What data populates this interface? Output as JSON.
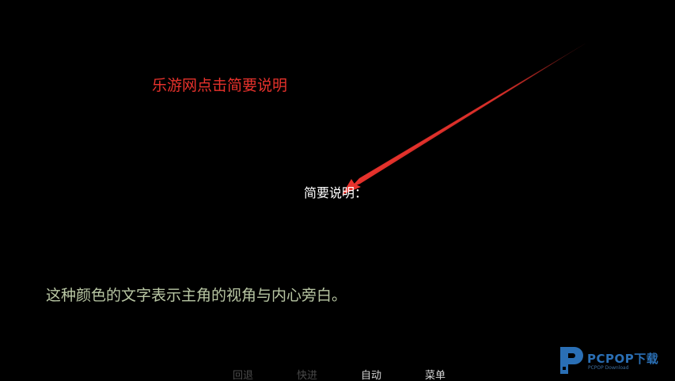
{
  "annotation": {
    "text": "乐游网点击简要说明",
    "color": "#e8322c"
  },
  "dialogue": {
    "title": "简要说明：",
    "narration": "这种颜色的文字表示主角的视角与内心旁白。",
    "narration_color": "#b9c7a4"
  },
  "quick_menu": {
    "items": [
      {
        "label": "回退",
        "enabled": false
      },
      {
        "label": "快进",
        "enabled": false
      },
      {
        "label": "自动",
        "enabled": true
      },
      {
        "label": "菜单",
        "enabled": true
      }
    ]
  },
  "watermark": {
    "brand": "PCPOP下载",
    "sub": "PCPOP Download",
    "color": "#2a6fb5"
  },
  "icons": {
    "arrow": "red-pointer-arrow-icon",
    "logo": "pcpop-logo-icon"
  }
}
